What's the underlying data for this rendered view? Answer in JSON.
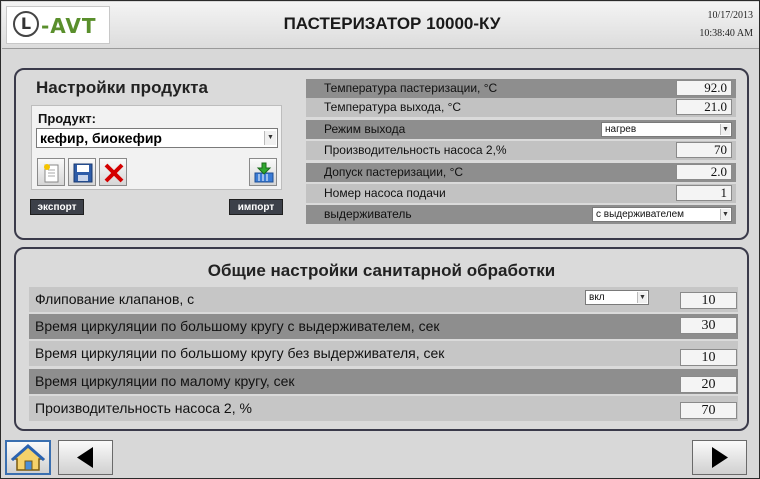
{
  "header": {
    "logo_text": "L-AVT",
    "title": "ПАСТЕРИЗАТОР 10000-КУ",
    "date": "10/17/2013",
    "time": "10:38:40 AM"
  },
  "product_settings": {
    "title": "Настройки продукта",
    "product_label": "Продукт:",
    "product_value": "кефир, биокефир",
    "export_label": "экспорт",
    "import_label": "импорт",
    "params": [
      {
        "label": "Температура пастеризации, °С",
        "value": "92.0"
      },
      {
        "label": "Температура выхода, °С",
        "value": "21.0"
      },
      {
        "label": "Режим выхода",
        "value": "нагрев"
      },
      {
        "label": "Производительность насоса 2,%",
        "value": "70"
      },
      {
        "label": "Допуск пастеризации, °С",
        "value": "2.0"
      },
      {
        "label": "Номер насоса подачи",
        "value": "1"
      },
      {
        "label": "выдерживатель",
        "value": "с выдерживателем"
      }
    ]
  },
  "sanitary_settings": {
    "title": "Общие настройки санитарной обработки",
    "flip_mode": "вкл",
    "rows": [
      {
        "label": "Флипование  клапанов, с",
        "value": "10"
      },
      {
        "label": "Время циркуляции по большому кругу с выдерживателем, сек",
        "value": "30"
      },
      {
        "label": "Время циркуляции по большому кругу без выдерживателя, сек",
        "value": "10"
      },
      {
        "label": "Время циркуляции по малому кругу, сек",
        "value": "20"
      },
      {
        "label": "Производительность насоса 2, %",
        "value": "70"
      }
    ]
  },
  "icons": [
    "new-file-icon",
    "save-icon",
    "delete-icon",
    "download-icon",
    "home-icon",
    "arrow-left-icon",
    "arrow-right-icon"
  ]
}
